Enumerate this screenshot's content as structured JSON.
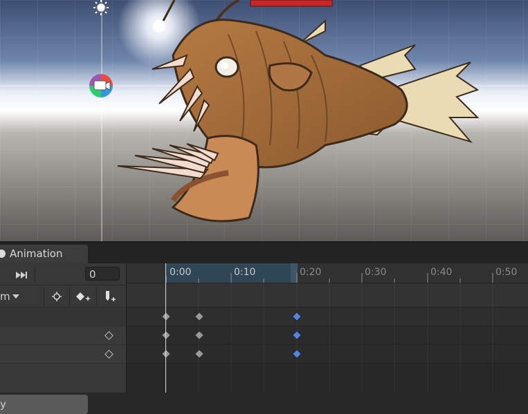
{
  "window": {
    "tab_title": "Animation"
  },
  "controls": {
    "frame_value": "0",
    "clip_dropdown_label": "m"
  },
  "timeline": {
    "ticks": [
      "0:00",
      "0:10",
      "0:20",
      "0:30",
      "0:40",
      "0:50"
    ]
  },
  "left": {
    "add_property_label": "y"
  },
  "colors": {
    "accent_key": "#4f86d8",
    "selected_range": "#2f4656",
    "playhead": "#dcdcdc"
  }
}
